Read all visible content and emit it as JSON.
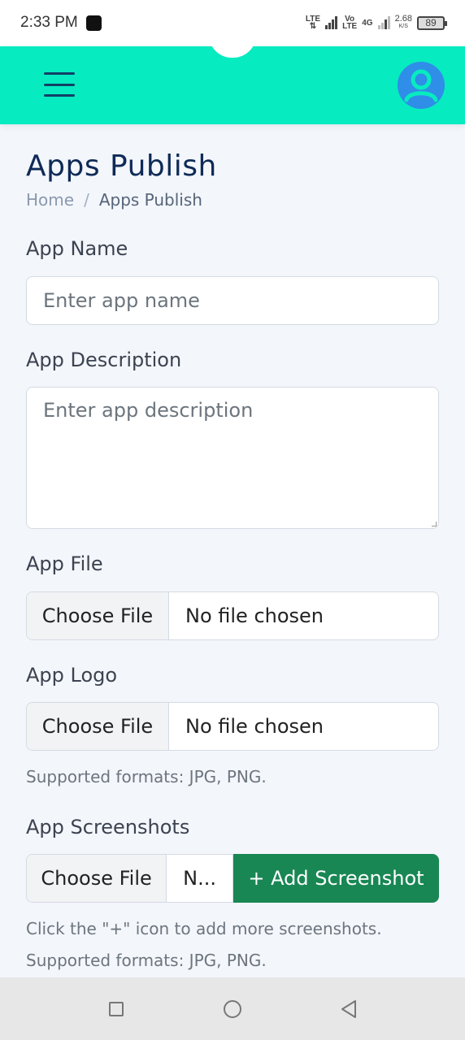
{
  "status_bar": {
    "time": "2:33 PM",
    "network_1": "LTE",
    "network_1_sub": "⇅",
    "network_2_top": "Vo",
    "network_2_bottom": "LTE",
    "network_3": "4G",
    "speed_value": "2.68",
    "speed_unit": "K/S",
    "battery": "89"
  },
  "header": {
    "menu_icon": "hamburger-menu-icon",
    "avatar_icon": "user-avatar-icon",
    "accent_color": "#07ebc0",
    "avatar_color": "#2f8ee7"
  },
  "page": {
    "title": "Apps Publish",
    "breadcrumb": {
      "home": "Home",
      "separator": "/",
      "current": "Apps Publish"
    }
  },
  "form": {
    "app_name": {
      "label": "App Name",
      "placeholder": "Enter app name",
      "value": ""
    },
    "app_description": {
      "label": "App Description",
      "placeholder": "Enter app description",
      "value": ""
    },
    "app_file": {
      "label": "App File",
      "button_label": "Choose File",
      "status": "No file chosen"
    },
    "app_logo": {
      "label": "App Logo",
      "button_label": "Choose File",
      "status": "No file chosen",
      "help": "Supported formats: JPG, PNG."
    },
    "app_screenshots": {
      "label": "App Screenshots",
      "button_label": "Choose File",
      "status": "N...",
      "add_button_label": "+ Add Screenshot",
      "add_button_color": "#198754",
      "help_1": "Click the \"+\" icon to add more screenshots.",
      "help_2": "Supported formats: JPG, PNG."
    }
  },
  "nav_bar": {
    "recent_icon": "recent-apps-icon",
    "home_icon": "home-circle-icon",
    "back_icon": "back-triangle-icon"
  }
}
